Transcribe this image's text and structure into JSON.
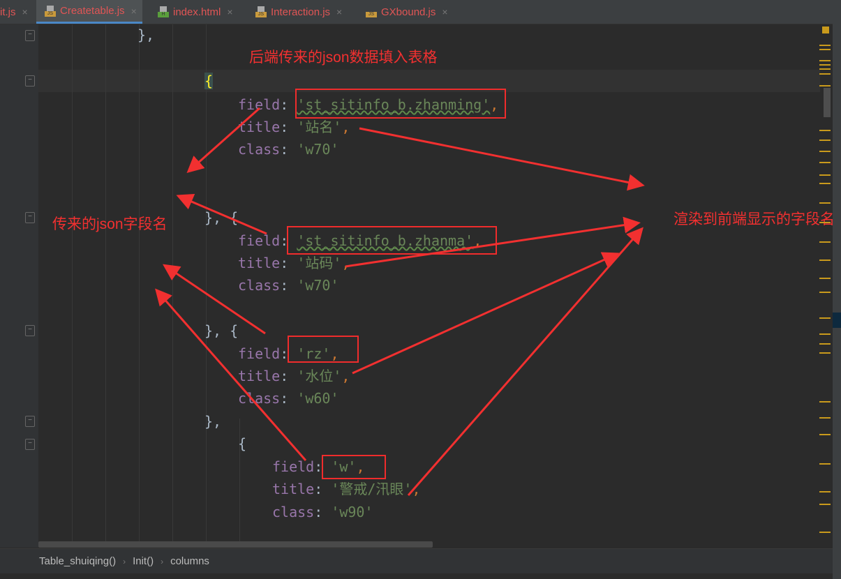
{
  "tabs": [
    {
      "label": "it.js",
      "icon": "js-file-icon",
      "badge": ""
    },
    {
      "label": "Createtable.js",
      "icon": "js-file-icon",
      "badge": "JS",
      "active": true
    },
    {
      "label": "index.html",
      "icon": "html-file-icon",
      "badge": "H"
    },
    {
      "label": "Interaction.js",
      "icon": "js-file-icon",
      "badge": "JS"
    },
    {
      "label": "GXbound.js",
      "icon": "binary-js-file-icon",
      "badge": "JS"
    }
  ],
  "close_glyph": "×",
  "code": {
    "close_brace_comma": "},",
    "open_brace": "{",
    "close_open": "}, {",
    "field_key": "field",
    "title_key": "title",
    "class_key": "class",
    "items": [
      {
        "field": "'st_sitinfo_b.zhanming'",
        "title": "'站名'",
        "class": "'w70'"
      },
      {
        "field": "'st_sitinfo_b.zhanma'",
        "title": "'站码'",
        "class": "'w70'"
      },
      {
        "field": "'rz'",
        "title": "'水位'",
        "class": "'w60'"
      },
      {
        "field": "'w'",
        "title": "'警戒/汛眼'",
        "class": "'w90'"
      }
    ]
  },
  "annotations": {
    "top": "后端传来的json数据填入表格",
    "left": "传来的json字段名",
    "right": "渲染到前端显示的字段名"
  },
  "breadcrumb": [
    "Table_shuiqing()",
    "Init()",
    "columns"
  ],
  "colors": {
    "annotation": "#f23030",
    "accent": "#4a88c7"
  }
}
